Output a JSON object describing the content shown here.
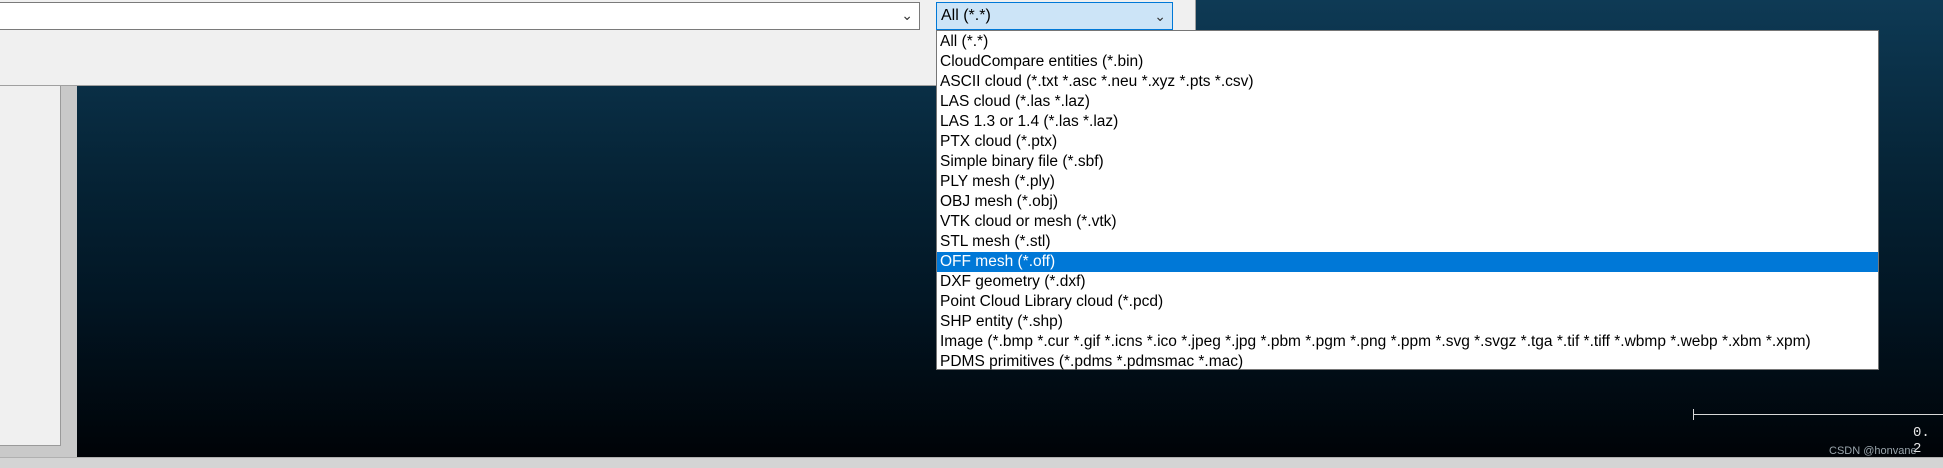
{
  "file_dialog": {
    "filename_value": "",
    "filter_selected": "All (*.*)",
    "filter_options": [
      {
        "label": "All (*.*)"
      },
      {
        "label": "CloudCompare entities (*.bin)"
      },
      {
        "label": "ASCII cloud (*.txt *.asc *.neu *.xyz *.pts *.csv)"
      },
      {
        "label": "LAS cloud (*.las *.laz)"
      },
      {
        "label": "LAS 1.3 or 1.4 (*.las *.laz)"
      },
      {
        "label": "PTX cloud (*.ptx)"
      },
      {
        "label": "Simple binary file (*.sbf)"
      },
      {
        "label": "PLY mesh (*.ply)"
      },
      {
        "label": "OBJ mesh (*.obj)"
      },
      {
        "label": "VTK cloud or mesh (*.vtk)"
      },
      {
        "label": "STL mesh (*.stl)"
      },
      {
        "label": "OFF mesh (*.off)",
        "highlighted": true
      },
      {
        "label": "DXF geometry (*.dxf)"
      },
      {
        "label": "Point Cloud Library cloud (*.pcd)"
      },
      {
        "label": "SHP entity (*.shp)"
      },
      {
        "label": "Image (*.bmp *.cur *.gif *.icns *.ico *.jpeg *.jpg *.pbm *.pgm *.png *.ppm *.svg *.svgz *.tga *.tif *.tiff *.wbmp *.webp *.xbm *.xpm)"
      },
      {
        "label": "PDMS primitives (*.pdms *.pdmsmac *.mac)"
      }
    ]
  },
  "viewport": {
    "scale_label": "0. 2",
    "watermark": "CSDN @honvane"
  },
  "colors": {
    "highlight": "#0078d7",
    "combo_focus_bg": "#cce4f7"
  },
  "icons": {
    "dropdown_arrow": "chevron-down-icon"
  }
}
